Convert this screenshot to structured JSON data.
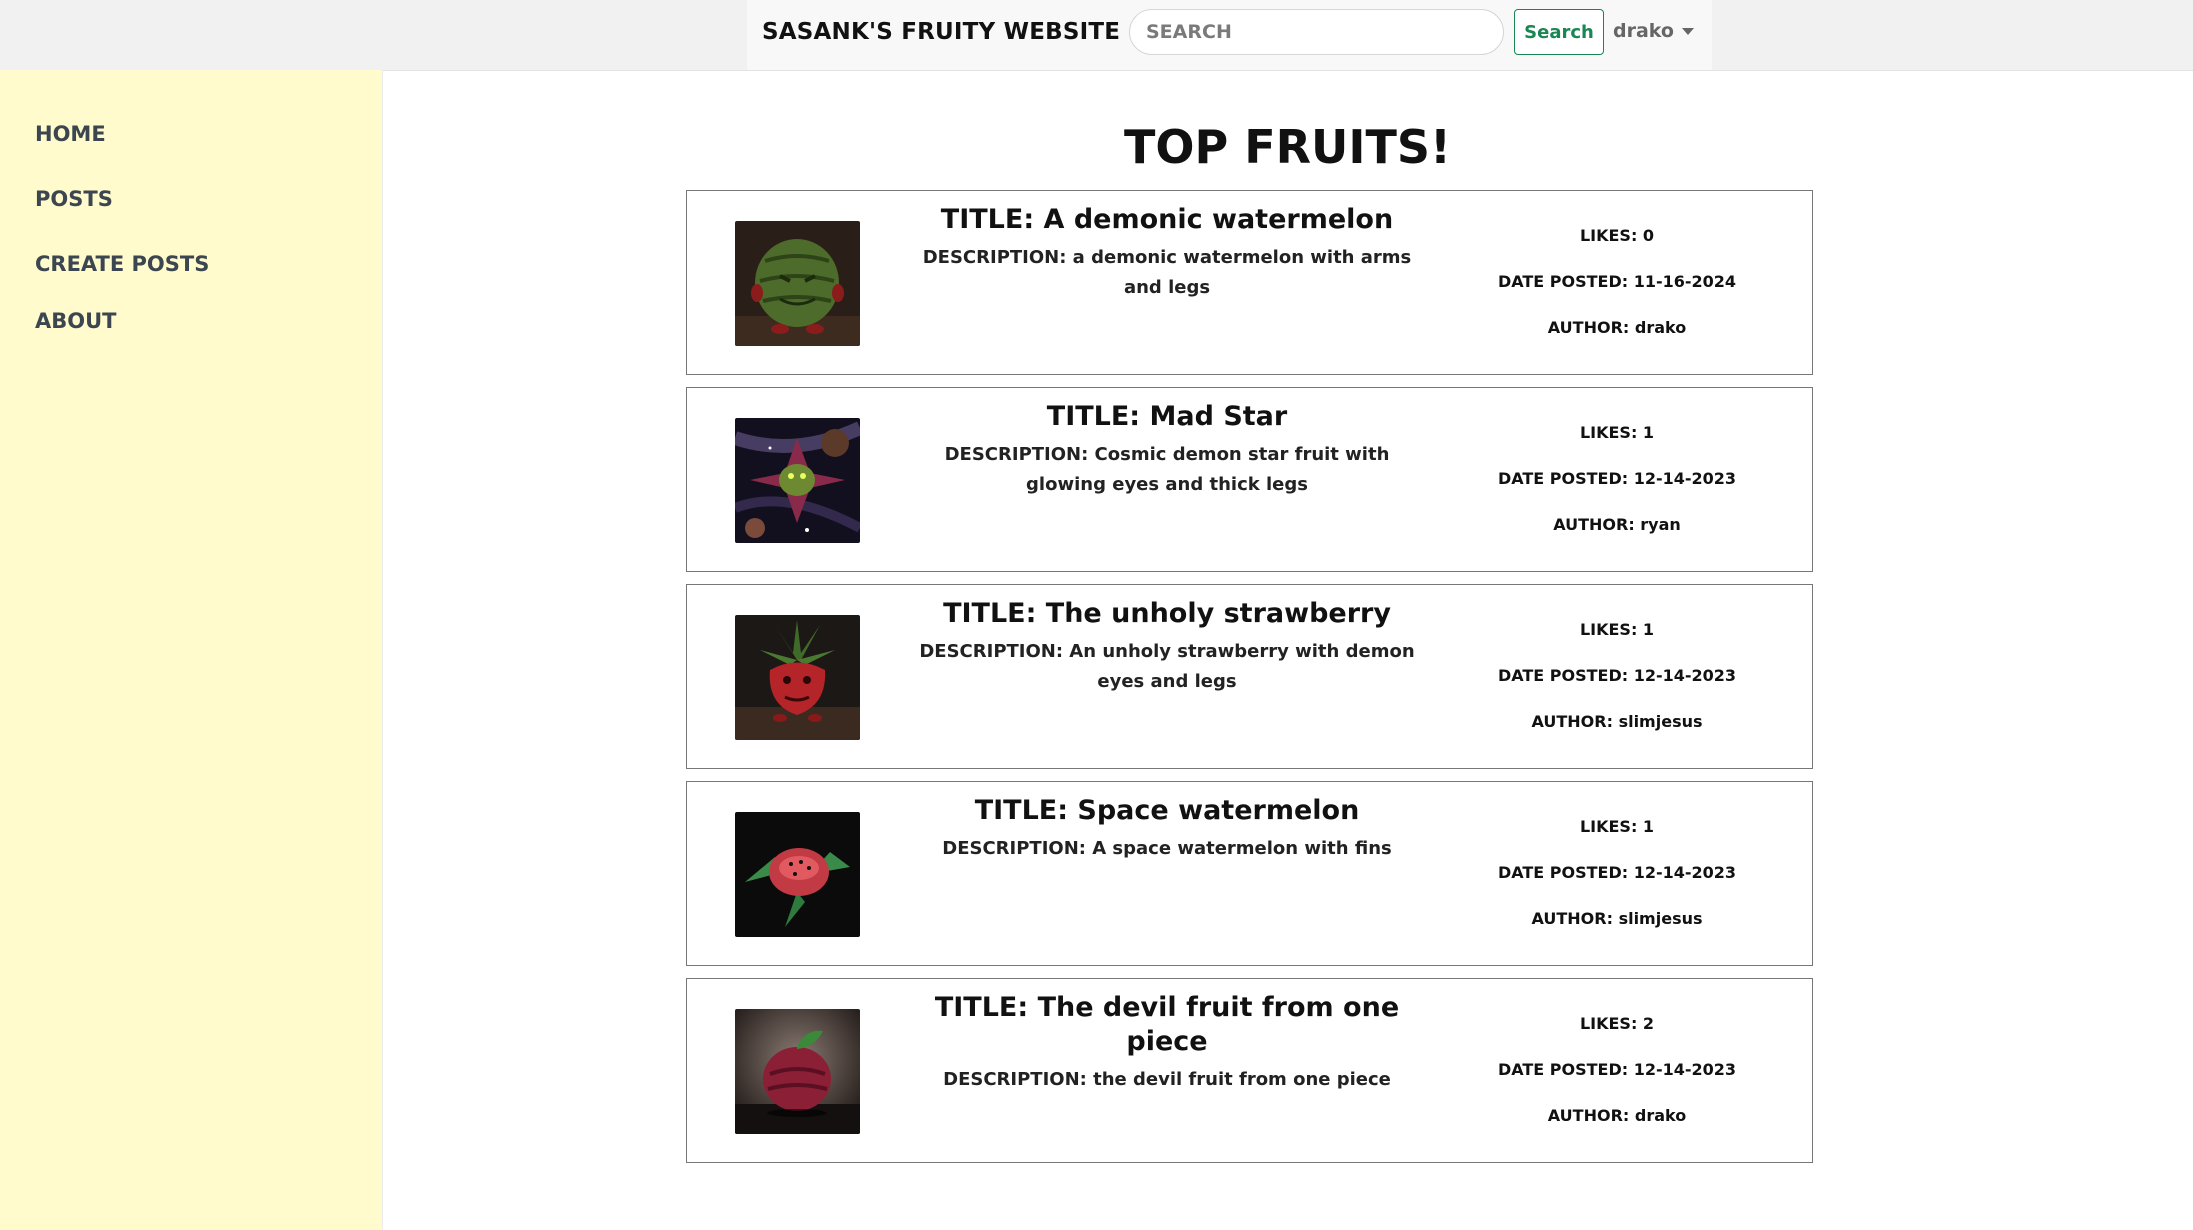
{
  "header": {
    "brand": "SASANK'S FRUITY WEBSITE",
    "brand_icon": "orange-fruit-icon",
    "search_placeholder": "SEARCH",
    "search_button": "Search",
    "user": "drako"
  },
  "sidebar": {
    "items": [
      {
        "label": "HOME"
      },
      {
        "label": "POSTS"
      },
      {
        "label": "CREATE POSTS"
      },
      {
        "label": "ABOUT"
      }
    ]
  },
  "main": {
    "title": "TOP FRUITS!",
    "posts": [
      {
        "title": "TITLE: A demonic watermelon",
        "description": "DESCRIPTION: a demonic watermelon with arms and legs",
        "likes": "LIKES: 0",
        "date": "DATE POSTED: 11-16-2024",
        "author": "AUTHOR: drako"
      },
      {
        "title": "TITLE: Mad Star",
        "description": "DESCRIPTION: Cosmic demon star fruit with glowing eyes and thick legs",
        "likes": "LIKES: 1",
        "date": "DATE POSTED: 12-14-2023",
        "author": "AUTHOR: ryan"
      },
      {
        "title": "TITLE: The unholy strawberry",
        "description": "DESCRIPTION: An unholy strawberry with demon eyes and legs",
        "likes": "LIKES: 1",
        "date": "DATE POSTED: 12-14-2023",
        "author": "AUTHOR: slimjesus"
      },
      {
        "title": "TITLE: Space watermelon",
        "description": "DESCRIPTION: A space watermelon with fins",
        "likes": "LIKES: 1",
        "date": "DATE POSTED: 12-14-2023",
        "author": "AUTHOR: slimjesus"
      },
      {
        "title": "TITLE: The devil fruit from one piece",
        "description": "DESCRIPTION: the devil fruit from one piece",
        "likes": "LIKES: 2",
        "date": "DATE POSTED: 12-14-2023",
        "author": "AUTHOR: drako"
      }
    ]
  },
  "colors": {
    "sidebar_bg": "#fffbcc",
    "search_button": "#198754"
  }
}
